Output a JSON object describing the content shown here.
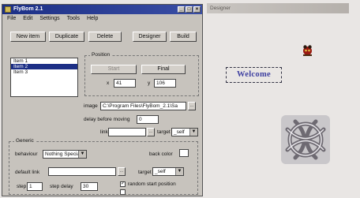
{
  "window": {
    "title": "FlyBom 2.1",
    "titlebar_buttons": [
      "_",
      "□",
      "×"
    ]
  },
  "menu": [
    "File",
    "Edit",
    "Settings",
    "Tools",
    "Help"
  ],
  "toolbar": {
    "new_item": "New item",
    "duplicate": "Duplicate",
    "delete": "Delete",
    "designer": "Designer",
    "build": "Build"
  },
  "items": [
    {
      "label": "Item 1",
      "selected": false
    },
    {
      "label": "Item 2",
      "selected": true
    },
    {
      "label": "Item 3",
      "selected": false
    }
  ],
  "position": {
    "label": "Position",
    "start_button": "Start",
    "final_button": "Final",
    "x_label": "x",
    "x_value": "41",
    "y_label": "y",
    "y_value": "106"
  },
  "image": {
    "label": "image",
    "path": "C:\\Program Files\\FlyBom_2.1\\Sa"
  },
  "delay": {
    "label": "delay before moving",
    "value": "0"
  },
  "link": {
    "label": "link",
    "value": "",
    "target_label": "target",
    "target_value": "_self"
  },
  "generic": {
    "label": "Generic",
    "behaviour_label": "behaviour",
    "behaviour_value": "Nothing Special",
    "back_color_label": "back color",
    "default_link_label": "default link",
    "default_link_value": "",
    "target_label": "target",
    "target_value": "_self",
    "step_label": "step",
    "step_value": "1",
    "step_delay_label": "step delay",
    "step_delay_value": "30",
    "random_start_label": "random start position",
    "random_start_checked": true,
    "second_checkbox_checked": false
  },
  "canvas": {
    "title": "Designer",
    "welcome_text": "Welcome"
  }
}
